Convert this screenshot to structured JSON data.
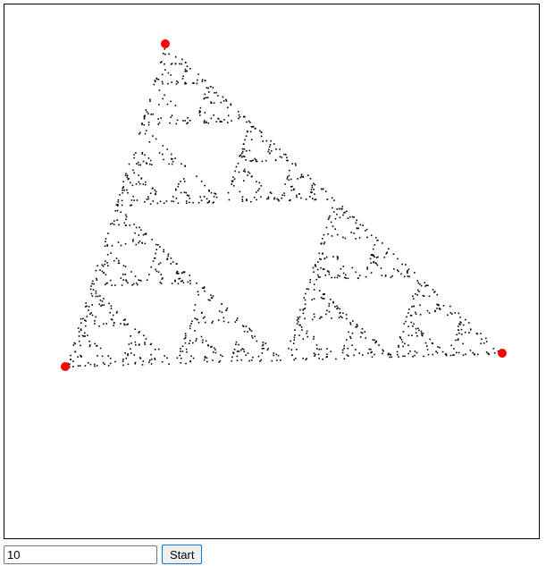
{
  "colors": {
    "point": "#000000",
    "vertex": "#ff0000",
    "border": "#000000",
    "background": "#ffffff"
  },
  "controls": {
    "iterations_value": "10",
    "start_label": "Start"
  }
}
